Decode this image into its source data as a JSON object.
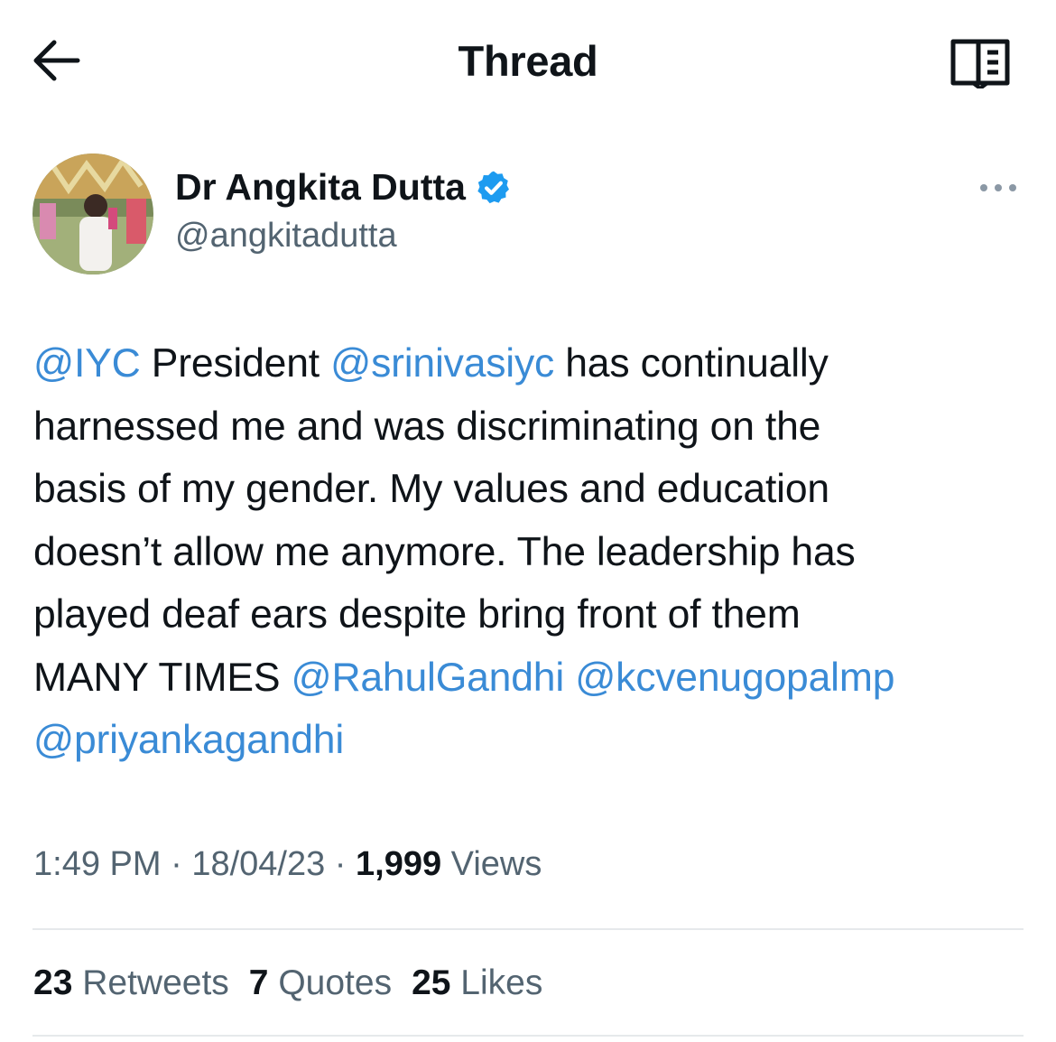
{
  "header": {
    "title": "Thread",
    "back_icon": "arrow-left-icon",
    "reader_icon": "reader-mode-icon"
  },
  "tweet": {
    "author": {
      "name": "Dr Angkita Dutta",
      "handle": "@angkitadutta",
      "verified_badge": "verified-badge-icon",
      "verified_color": "#1d9bf0"
    },
    "more_icon": "more-horizontal-icon",
    "text_lines": [
      [
        {
          "t": "@IYC",
          "m": true
        },
        {
          "t": " President ",
          "m": false
        },
        {
          "t": "@srinivasiyc",
          "m": true
        },
        {
          "t": " has continually",
          "m": false
        }
      ],
      [
        {
          "t": "harnessed me and was discriminating on the",
          "m": false
        }
      ],
      [
        {
          "t": "basis of my gender. My values and education",
          "m": false
        }
      ],
      [
        {
          "t": "doesn’t allow me  anymore. The leadership has",
          "m": false
        }
      ],
      [
        {
          "t": "played deaf ears despite bring front of them",
          "m": false
        }
      ],
      [
        {
          "t": "MANY TIMES ",
          "m": false
        },
        {
          "t": "@RahulGandhi",
          "m": true
        },
        {
          "t": " ",
          "m": false
        },
        {
          "t": "@kcvenugopalmp",
          "m": true
        }
      ],
      [
        {
          "t": "@priyankagandhi",
          "m": true
        }
      ]
    ],
    "meta": {
      "time": "1:49 PM",
      "sep1": " · ",
      "date": "18/04/23",
      "sep2": " · ",
      "views_count": "1,999",
      "views_label": " Views"
    },
    "stats": {
      "retweets_count": "23",
      "retweets_label": " Retweets",
      "quotes_count": "7",
      "quotes_label": " Quotes",
      "likes_count": "25",
      "likes_label": " Likes"
    }
  },
  "colors": {
    "mention": "#3a8bd6",
    "secondary_text": "#536471",
    "primary_text": "#0f1419",
    "divider": "#e6e9eb"
  }
}
